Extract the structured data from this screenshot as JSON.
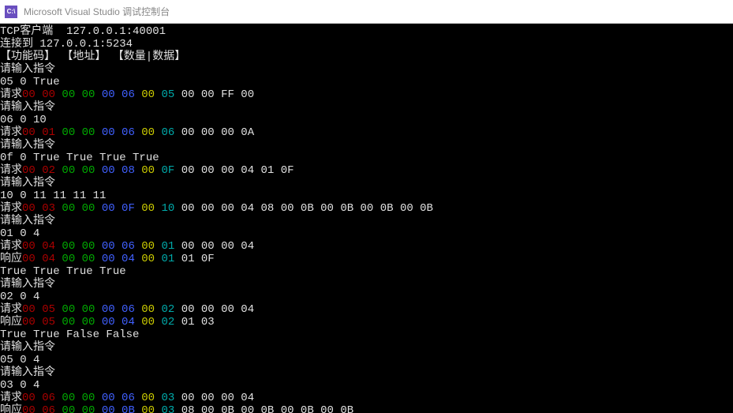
{
  "window": {
    "icon_text": "C:\\",
    "title": "Microsoft Visual Studio 调试控制台"
  },
  "lines": [
    [
      {
        "c": "white",
        "t": "TCP客户端  127.0.0.1:40001"
      }
    ],
    [
      {
        "c": "white",
        "t": "连接到 127.0.0.1:5234"
      }
    ],
    [
      {
        "c": "white",
        "t": "【功能码】 【地址】 【数量|数据】"
      }
    ],
    [
      {
        "c": "white",
        "t": "请输入指令"
      }
    ],
    [
      {
        "c": "white",
        "t": "05 0 True"
      }
    ],
    [
      {
        "c": "white",
        "t": "请求"
      },
      {
        "c": "red",
        "t": "00 00"
      },
      {
        "c": "white",
        "t": " "
      },
      {
        "c": "green",
        "t": "00 00"
      },
      {
        "c": "white",
        "t": " "
      },
      {
        "c": "blue",
        "t": "00 06"
      },
      {
        "c": "white",
        "t": " "
      },
      {
        "c": "yellow",
        "t": "00"
      },
      {
        "c": "white",
        "t": " "
      },
      {
        "c": "cyan",
        "t": "05"
      },
      {
        "c": "white",
        "t": " 00 00 FF 00"
      }
    ],
    [
      {
        "c": "white",
        "t": "请输入指令"
      }
    ],
    [
      {
        "c": "white",
        "t": "06 0 10"
      }
    ],
    [
      {
        "c": "white",
        "t": "请求"
      },
      {
        "c": "red",
        "t": "00 01"
      },
      {
        "c": "white",
        "t": " "
      },
      {
        "c": "green",
        "t": "00 00"
      },
      {
        "c": "white",
        "t": " "
      },
      {
        "c": "blue",
        "t": "00 06"
      },
      {
        "c": "white",
        "t": " "
      },
      {
        "c": "yellow",
        "t": "00"
      },
      {
        "c": "white",
        "t": " "
      },
      {
        "c": "cyan",
        "t": "06"
      },
      {
        "c": "white",
        "t": " 00 00 00 0A"
      }
    ],
    [
      {
        "c": "white",
        "t": "请输入指令"
      }
    ],
    [
      {
        "c": "white",
        "t": "0f 0 True True True True"
      }
    ],
    [
      {
        "c": "white",
        "t": "请求"
      },
      {
        "c": "red",
        "t": "00 02"
      },
      {
        "c": "white",
        "t": " "
      },
      {
        "c": "green",
        "t": "00 00"
      },
      {
        "c": "white",
        "t": " "
      },
      {
        "c": "blue",
        "t": "00 08"
      },
      {
        "c": "white",
        "t": " "
      },
      {
        "c": "yellow",
        "t": "00"
      },
      {
        "c": "white",
        "t": " "
      },
      {
        "c": "cyan",
        "t": "0F"
      },
      {
        "c": "white",
        "t": " 00 00 00 04 01 0F"
      }
    ],
    [
      {
        "c": "white",
        "t": "请输入指令"
      }
    ],
    [
      {
        "c": "white",
        "t": "10 0 11 11 11 11"
      }
    ],
    [
      {
        "c": "white",
        "t": "请求"
      },
      {
        "c": "red",
        "t": "00 03"
      },
      {
        "c": "white",
        "t": " "
      },
      {
        "c": "green",
        "t": "00 00"
      },
      {
        "c": "white",
        "t": " "
      },
      {
        "c": "blue",
        "t": "00 0F"
      },
      {
        "c": "white",
        "t": " "
      },
      {
        "c": "yellow",
        "t": "00"
      },
      {
        "c": "white",
        "t": " "
      },
      {
        "c": "cyan",
        "t": "10"
      },
      {
        "c": "white",
        "t": " 00 00 00 04 08 00 0B 00 0B 00 0B 00 0B"
      }
    ],
    [
      {
        "c": "white",
        "t": "请输入指令"
      }
    ],
    [
      {
        "c": "white",
        "t": "01 0 4"
      }
    ],
    [
      {
        "c": "white",
        "t": "请求"
      },
      {
        "c": "red",
        "t": "00 04"
      },
      {
        "c": "white",
        "t": " "
      },
      {
        "c": "green",
        "t": "00 00"
      },
      {
        "c": "white",
        "t": " "
      },
      {
        "c": "blue",
        "t": "00 06"
      },
      {
        "c": "white",
        "t": " "
      },
      {
        "c": "yellow",
        "t": "00"
      },
      {
        "c": "white",
        "t": " "
      },
      {
        "c": "cyan",
        "t": "01"
      },
      {
        "c": "white",
        "t": " 00 00 00 04"
      }
    ],
    [
      {
        "c": "white",
        "t": "响应"
      },
      {
        "c": "red",
        "t": "00 04"
      },
      {
        "c": "white",
        "t": " "
      },
      {
        "c": "green",
        "t": "00 00"
      },
      {
        "c": "white",
        "t": " "
      },
      {
        "c": "blue",
        "t": "00 04"
      },
      {
        "c": "white",
        "t": " "
      },
      {
        "c": "yellow",
        "t": "00"
      },
      {
        "c": "white",
        "t": " "
      },
      {
        "c": "cyan",
        "t": "01"
      },
      {
        "c": "white",
        "t": " 01 0F"
      }
    ],
    [
      {
        "c": "white",
        "t": "True True True True"
      }
    ],
    [
      {
        "c": "white",
        "t": "请输入指令"
      }
    ],
    [
      {
        "c": "white",
        "t": "02 0 4"
      }
    ],
    [
      {
        "c": "white",
        "t": "请求"
      },
      {
        "c": "red",
        "t": "00 05"
      },
      {
        "c": "white",
        "t": " "
      },
      {
        "c": "green",
        "t": "00 00"
      },
      {
        "c": "white",
        "t": " "
      },
      {
        "c": "blue",
        "t": "00 06"
      },
      {
        "c": "white",
        "t": " "
      },
      {
        "c": "yellow",
        "t": "00"
      },
      {
        "c": "white",
        "t": " "
      },
      {
        "c": "cyan",
        "t": "02"
      },
      {
        "c": "white",
        "t": " 00 00 00 04"
      }
    ],
    [
      {
        "c": "white",
        "t": "响应"
      },
      {
        "c": "red",
        "t": "00 05"
      },
      {
        "c": "white",
        "t": " "
      },
      {
        "c": "green",
        "t": "00 00"
      },
      {
        "c": "white",
        "t": " "
      },
      {
        "c": "blue",
        "t": "00 04"
      },
      {
        "c": "white",
        "t": " "
      },
      {
        "c": "yellow",
        "t": "00"
      },
      {
        "c": "white",
        "t": " "
      },
      {
        "c": "cyan",
        "t": "02"
      },
      {
        "c": "white",
        "t": " 01 03"
      }
    ],
    [
      {
        "c": "white",
        "t": "True True False False"
      }
    ],
    [
      {
        "c": "white",
        "t": "请输入指令"
      }
    ],
    [
      {
        "c": "white",
        "t": "05 0 4"
      }
    ],
    [
      {
        "c": "white",
        "t": "请输入指令"
      }
    ],
    [
      {
        "c": "white",
        "t": "03 0 4"
      }
    ],
    [
      {
        "c": "white",
        "t": "请求"
      },
      {
        "c": "red",
        "t": "00 06"
      },
      {
        "c": "white",
        "t": " "
      },
      {
        "c": "green",
        "t": "00 00"
      },
      {
        "c": "white",
        "t": " "
      },
      {
        "c": "blue",
        "t": "00 06"
      },
      {
        "c": "white",
        "t": " "
      },
      {
        "c": "yellow",
        "t": "00"
      },
      {
        "c": "white",
        "t": " "
      },
      {
        "c": "cyan",
        "t": "03"
      },
      {
        "c": "white",
        "t": " 00 00 00 04"
      }
    ],
    [
      {
        "c": "white",
        "t": "响应"
      },
      {
        "c": "red",
        "t": "00 06"
      },
      {
        "c": "white",
        "t": " "
      },
      {
        "c": "green",
        "t": "00 00"
      },
      {
        "c": "white",
        "t": " "
      },
      {
        "c": "blue",
        "t": "00 0B"
      },
      {
        "c": "white",
        "t": " "
      },
      {
        "c": "yellow",
        "t": "00"
      },
      {
        "c": "white",
        "t": " "
      },
      {
        "c": "cyan",
        "t": "03"
      },
      {
        "c": "white",
        "t": " 08 00 0B 00 0B 00 0B 00 0B"
      }
    ]
  ]
}
